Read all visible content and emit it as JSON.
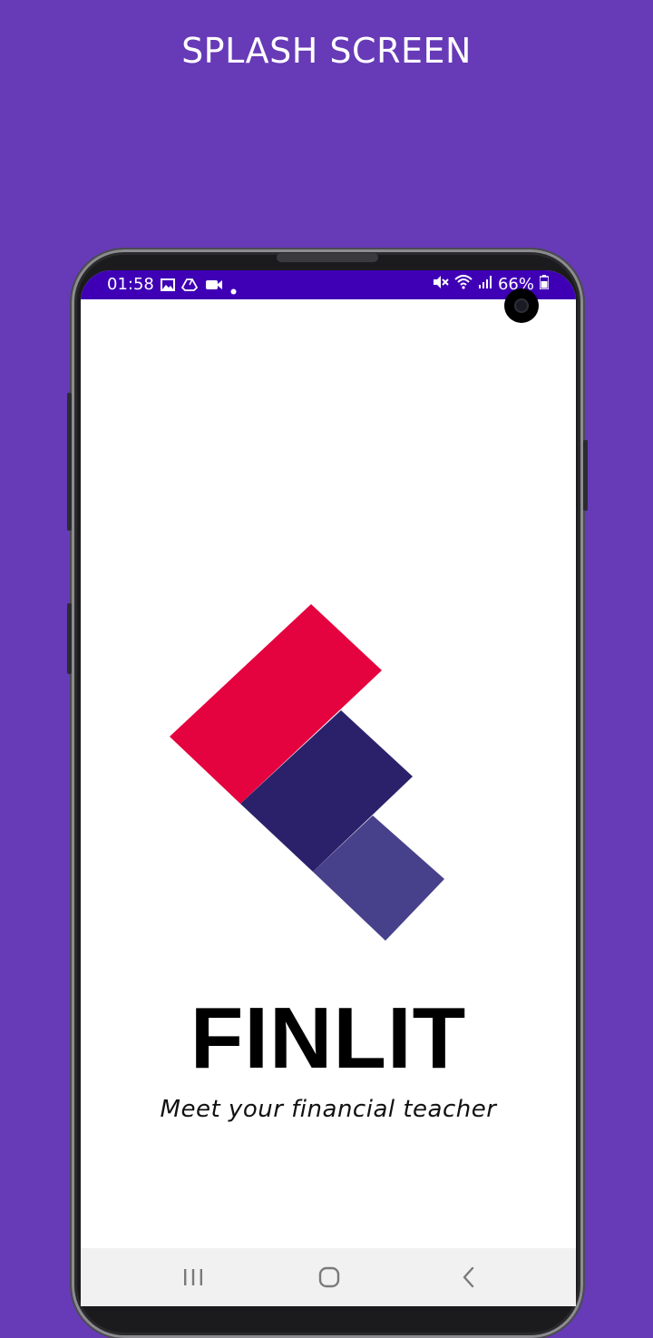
{
  "header": {
    "title": "SPLASH SCREEN"
  },
  "status_bar": {
    "time": "01:58",
    "battery": "66%",
    "left_icons": [
      "image-icon",
      "drive-icon",
      "video-icon",
      "dot-icon"
    ],
    "right_icons": [
      "mute-icon",
      "wifi-icon",
      "signal-icon",
      "battery-icon"
    ]
  },
  "app": {
    "name": "FINLIT",
    "tagline": "Meet your financial teacher"
  },
  "logo": {
    "colors": {
      "red": "#e4023f",
      "navy": "#2b216b",
      "indigo": "#47418b"
    }
  },
  "colors": {
    "background": "#673ab7",
    "status_bar": "#3f00b5",
    "screen": "#ffffff",
    "nav_bar": "#f1f1f1"
  },
  "nav_bar": {
    "buttons": [
      "recents-icon",
      "home-icon",
      "back-icon"
    ]
  }
}
